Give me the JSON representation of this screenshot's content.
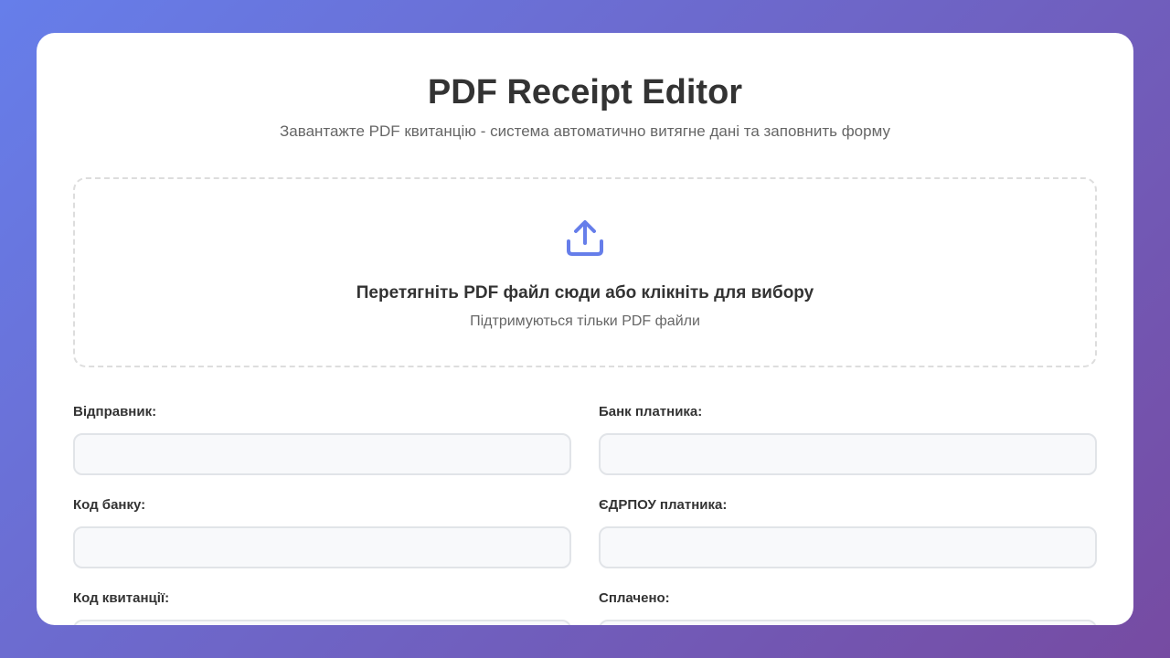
{
  "header": {
    "title": "PDF Receipt Editor",
    "subtitle": "Завантажте PDF квитанцію - система автоматично витягне дані та заповнить форму"
  },
  "upload": {
    "icon": "upload-icon",
    "main_text": "Перетягніть PDF файл сюди або клікніть для вибору",
    "sub_text": "Підтримуються тільки PDF файли"
  },
  "form": {
    "fields": [
      {
        "label": "Відправник:",
        "value": ""
      },
      {
        "label": "Банк платника:",
        "value": ""
      },
      {
        "label": "Код банку:",
        "value": ""
      },
      {
        "label": "ЄДРПОУ платника:",
        "value": ""
      },
      {
        "label": "Код квитанції:",
        "value": ""
      },
      {
        "label": "Сплачено:",
        "value": ""
      }
    ]
  },
  "colors": {
    "background_start": "#667eea",
    "background_end": "#764ba2",
    "accent": "#667eea",
    "card": "#ffffff",
    "input_background": "#f8f9fb",
    "input_border": "#e1e4e8"
  }
}
